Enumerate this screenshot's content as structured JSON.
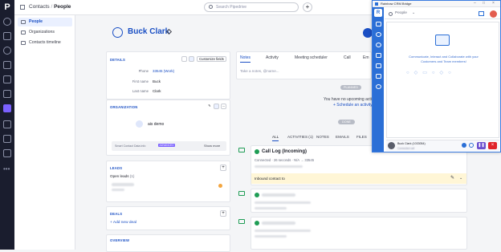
{
  "topbar": {
    "breadcrumb_parent": "Contacts",
    "breadcrumb_sep": "/",
    "breadcrumb_current": "People",
    "search_placeholder": "Search Pipedrive",
    "add_label": "+"
  },
  "nav": {
    "items": [
      {
        "label": "People",
        "selected": true
      },
      {
        "label": "Organizations",
        "selected": false
      },
      {
        "label": "Contacts timeline",
        "selected": false
      }
    ]
  },
  "person": {
    "name": "Buck Clark"
  },
  "details": {
    "header": "DETAILS",
    "customize_label": "Customize fields",
    "fields": [
      {
        "label": "Phone",
        "value": "33545 (Work)"
      },
      {
        "label": "First name",
        "value": "Buck"
      },
      {
        "label": "Last name",
        "value": "Clark"
      }
    ]
  },
  "organization": {
    "header": "ORGANIZATION",
    "name": "ais demo",
    "smart_text": "Smart Contact Data info",
    "smart_badge": "ADVANCED",
    "show_more": "Show more"
  },
  "leads": {
    "header": "LEADS",
    "open_leads": "Open leads",
    "count": "(1)"
  },
  "deals": {
    "header": "DEALS",
    "add_deal": "+ Add new deal"
  },
  "overview": {
    "header": "OVERVIEW"
  },
  "composer": {
    "tabs": [
      "Notes",
      "Activity",
      "Meeting scheduler",
      "Call",
      "Em"
    ],
    "placeholder": "Take a notes, @name..."
  },
  "timeline": {
    "planned_badge": "PLANNED",
    "no_activities": "You have no upcoming activ",
    "schedule_link": "+ Schedule an activity",
    "done_badge": "DONE",
    "filters": [
      "ALL",
      "ACTIVITIES (1)",
      "NOTES",
      "EMAILS",
      "FILES"
    ],
    "call_title": "Call Log (Incoming)",
    "call_meta": "Connected · 26 seconds · N/A → 33545",
    "connected_label": "Inbound contact to"
  },
  "crm": {
    "title": "Rainbow CRM Bridge",
    "search_label": "People",
    "tagline_1": "Communicate, Interact and Collaborate with your",
    "tagline_2": "Customers and Team members!",
    "caller_name": "Buck Clark (1033054)",
    "caller_status": "Connected call"
  },
  "colors": {
    "accent": "#1a4fc4",
    "rail": "#1a1d2e",
    "crm_blue": "#2b6fd6",
    "success": "#1f9d55"
  }
}
